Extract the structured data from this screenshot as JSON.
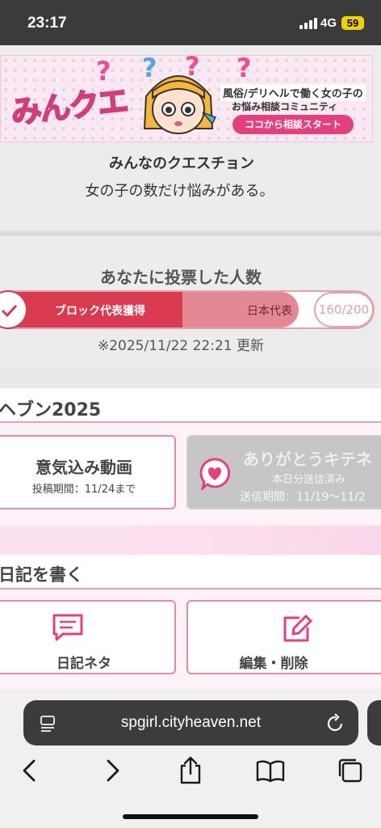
{
  "status_bar": {
    "time": "23:17",
    "network": "4G",
    "battery": "59"
  },
  "banner": {
    "logo_text": "みんクエ",
    "caption_line1": "風俗/デリヘルで働く女の子の",
    "caption_line2": "お悩み相談コミュニティ",
    "cta": "ココから相談スタート"
  },
  "question": {
    "title": "みんなのクエスチョン",
    "subtitle": "女の子の数だけ悩みがある。"
  },
  "vote": {
    "title": "あなたに投票した人数",
    "tier1_label": "ブロック代表獲得",
    "tier2_label": "日本代表",
    "count": "160/200",
    "progress_fraction": 0.8,
    "updated": "※2025/11/22 22:21 更新"
  },
  "heaven": {
    "section_title": "ヘブン2025",
    "card1_title": "意気込み動画",
    "card1_sub": "投稿期間：11/24まで",
    "card2_title": "ありがとうキテネ",
    "card2_sub1": "本日分送信済み",
    "card2_sub2": "送信期間：11/19〜11/2"
  },
  "diary": {
    "section_title": "日記を書く",
    "card1_label": "日記ネタ",
    "card2_label": "編集・削除"
  },
  "browser": {
    "url": "spgirl.cityheaven.net"
  },
  "colors": {
    "accent_pink": "#e6407c",
    "vote_red": "#d93a50"
  }
}
